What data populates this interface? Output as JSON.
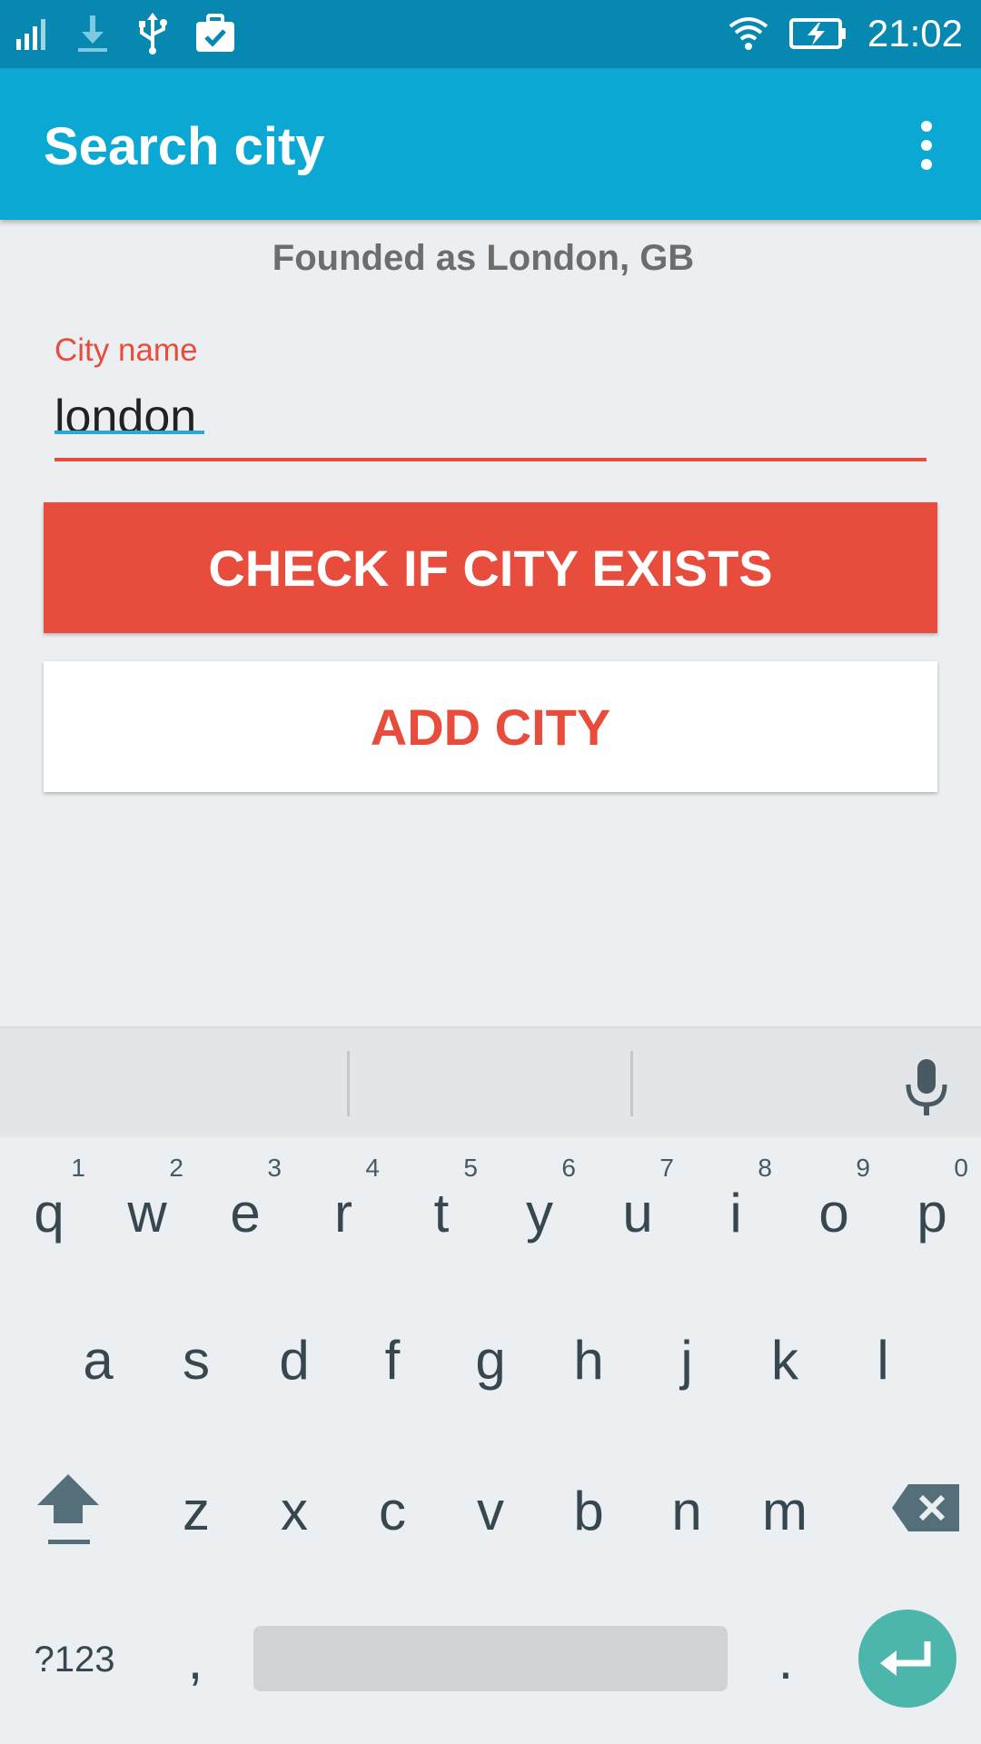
{
  "status_bar": {
    "time": "21:02"
  },
  "app_bar": {
    "title": "Search city"
  },
  "result": {
    "text": "Founded as London, GB"
  },
  "city_field": {
    "label": "City name",
    "value": "london"
  },
  "buttons": {
    "check": "CHECK IF CITY EXISTS",
    "add": "ADD CITY"
  },
  "keyboard": {
    "row1": [
      {
        "key": "q",
        "hint": "1"
      },
      {
        "key": "w",
        "hint": "2"
      },
      {
        "key": "e",
        "hint": "3"
      },
      {
        "key": "r",
        "hint": "4"
      },
      {
        "key": "t",
        "hint": "5"
      },
      {
        "key": "y",
        "hint": "6"
      },
      {
        "key": "u",
        "hint": "7"
      },
      {
        "key": "i",
        "hint": "8"
      },
      {
        "key": "o",
        "hint": "9"
      },
      {
        "key": "p",
        "hint": "0"
      }
    ],
    "row2": [
      "a",
      "s",
      "d",
      "f",
      "g",
      "h",
      "j",
      "k",
      "l"
    ],
    "row3": [
      "z",
      "x",
      "c",
      "v",
      "b",
      "n",
      "m"
    ],
    "symbols_key": "?123",
    "comma_key": ",",
    "period_key": "."
  },
  "colors": {
    "status_bar": "#0788b0",
    "app_bar": "#0ba8d4",
    "accent": "#e74c3c",
    "enter": "#4db6ac"
  }
}
